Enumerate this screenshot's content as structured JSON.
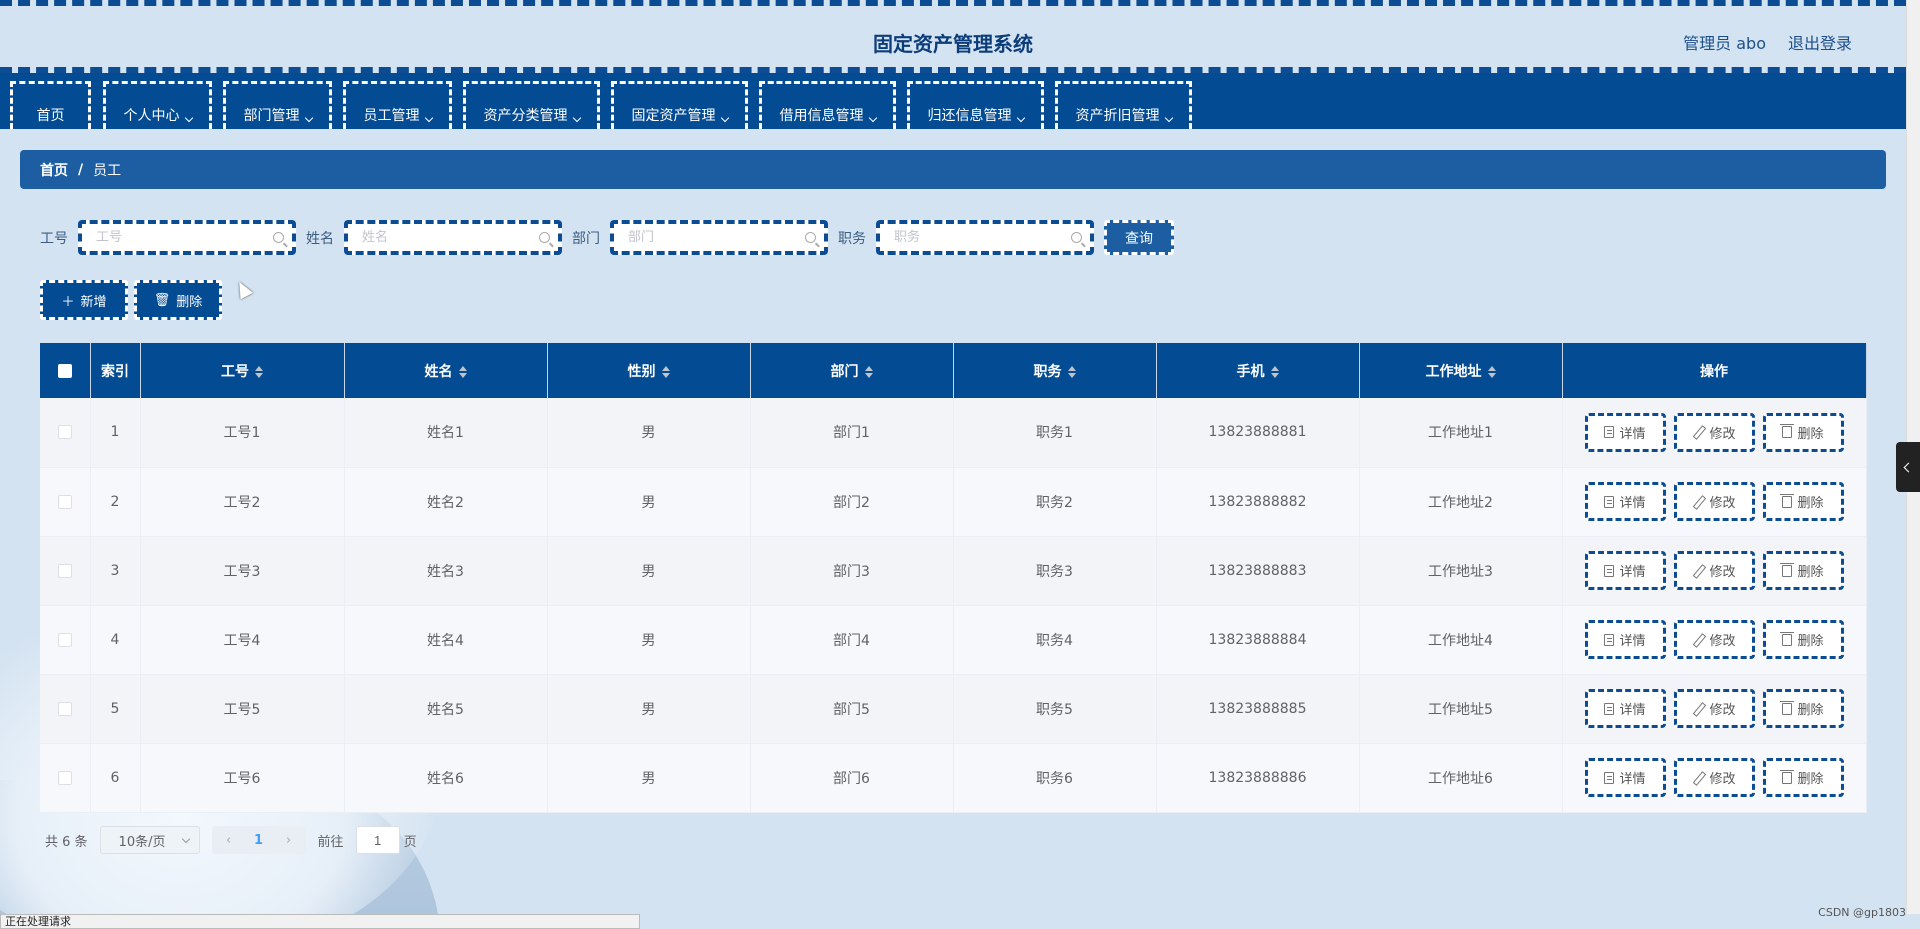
{
  "header": {
    "title": "固定资产管理系统",
    "user": "管理员 abo",
    "logout": "退出登录"
  },
  "nav": [
    {
      "label": "首页",
      "dropdown": false
    },
    {
      "label": "个人中心",
      "dropdown": true
    },
    {
      "label": "部门管理",
      "dropdown": true
    },
    {
      "label": "员工管理",
      "dropdown": true
    },
    {
      "label": "资产分类管理",
      "dropdown": true
    },
    {
      "label": "固定资产管理",
      "dropdown": true
    },
    {
      "label": "借用信息管理",
      "dropdown": true
    },
    {
      "label": "归还信息管理",
      "dropdown": true
    },
    {
      "label": "资产折旧管理",
      "dropdown": true
    }
  ],
  "breadcrumb": {
    "home": "首页",
    "sep": "/",
    "current": "员工"
  },
  "search": {
    "fields": [
      {
        "label": "工号",
        "placeholder": "工号"
      },
      {
        "label": "姓名",
        "placeholder": "姓名"
      },
      {
        "label": "部门",
        "placeholder": "部门"
      },
      {
        "label": "职务",
        "placeholder": "职务"
      }
    ],
    "query_label": "查询"
  },
  "actions": {
    "add_label": "新增",
    "delete_label": "删除"
  },
  "table": {
    "columns": [
      "索引",
      "工号",
      "姓名",
      "性别",
      "部门",
      "职务",
      "手机",
      "工作地址",
      "操作"
    ],
    "rows": [
      {
        "index": "1",
        "id": "工号1",
        "name": "姓名1",
        "gender": "男",
        "dept": "部门1",
        "title": "职务1",
        "phone": "13823888881",
        "address": "工作地址1"
      },
      {
        "index": "2",
        "id": "工号2",
        "name": "姓名2",
        "gender": "男",
        "dept": "部门2",
        "title": "职务2",
        "phone": "13823888882",
        "address": "工作地址2"
      },
      {
        "index": "3",
        "id": "工号3",
        "name": "姓名3",
        "gender": "男",
        "dept": "部门3",
        "title": "职务3",
        "phone": "13823888883",
        "address": "工作地址3"
      },
      {
        "index": "4",
        "id": "工号4",
        "name": "姓名4",
        "gender": "男",
        "dept": "部门4",
        "title": "职务4",
        "phone": "13823888884",
        "address": "工作地址4"
      },
      {
        "index": "5",
        "id": "工号5",
        "name": "姓名5",
        "gender": "男",
        "dept": "部门5",
        "title": "职务5",
        "phone": "13823888885",
        "address": "工作地址5"
      },
      {
        "index": "6",
        "id": "工号6",
        "name": "姓名6",
        "gender": "男",
        "dept": "部门6",
        "title": "职务6",
        "phone": "13823888886",
        "address": "工作地址6"
      }
    ],
    "op_detail": "详情",
    "op_edit": "修改",
    "op_delete": "删除"
  },
  "pagination": {
    "total": "共 6 条",
    "page_size": "10条/页",
    "current_page": "1",
    "goto_prefix": "前往",
    "goto_value": "1",
    "goto_suffix": "页"
  },
  "status_text": "正在处理请求",
  "watermark": "CSDN @gp1803",
  "colors": {
    "primary": "#034b93",
    "accent": "#1d5ea2",
    "background": "#d4e3f1"
  }
}
